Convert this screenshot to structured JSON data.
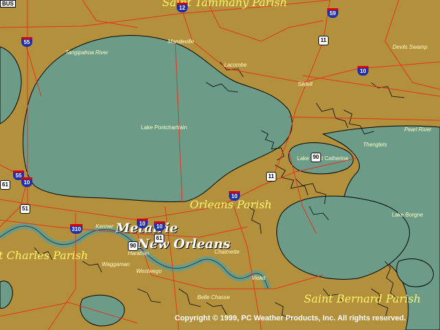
{
  "colors": {
    "land": "#b3913c",
    "water": "#6c9b88",
    "road": "#e3321e",
    "border": "#000000",
    "label": "#fffbc8",
    "parish": "#fff46a"
  },
  "labels": {
    "st_tammany": "Saint Tammany Parish",
    "tangipahoa_river": "Tangipahoa River",
    "mandeville": "Mandeville",
    "lacombe": "Lacombe",
    "slidell": "Slidell",
    "devils_swamp": "Devils Swamp",
    "pearl_river": "Pearl River",
    "lake_pontchartrain": "Lake Pontchartrain",
    "lake_catherine": "Lake Saint Catherine",
    "thenglets": "Thenglets",
    "orleans_parish": "Orleans Parish",
    "lake_borgne": "Lake Borgne",
    "kenner": "Kenner",
    "metairie": "Metairie",
    "new_orleans": "New Orleans",
    "charles_parish": "t Charles Parish",
    "harahan": "Harahan",
    "waggaman": "Waggaman",
    "westwego": "Westwego",
    "chalmette": "Chalmette",
    "belle_chasse": "Belle Chasse",
    "violet": "Violet",
    "st_bernard": "Saint Bernard Parish",
    "copyright": "Copyright © 1999, PC Weather Products, Inc.   All rights reserved."
  },
  "shields": {
    "i12": "12",
    "i59": "59",
    "i55": "55",
    "us11_n": "11",
    "i10_e": "10",
    "us90": "90",
    "i10_w": "10",
    "us61": "61",
    "us51": "51",
    "i10_c": "10",
    "us11_s": "11",
    "i310": "310",
    "i10_m1": "10",
    "i10_m2": "10",
    "us90b": "90",
    "us61b": "61",
    "bus": "BUS"
  }
}
